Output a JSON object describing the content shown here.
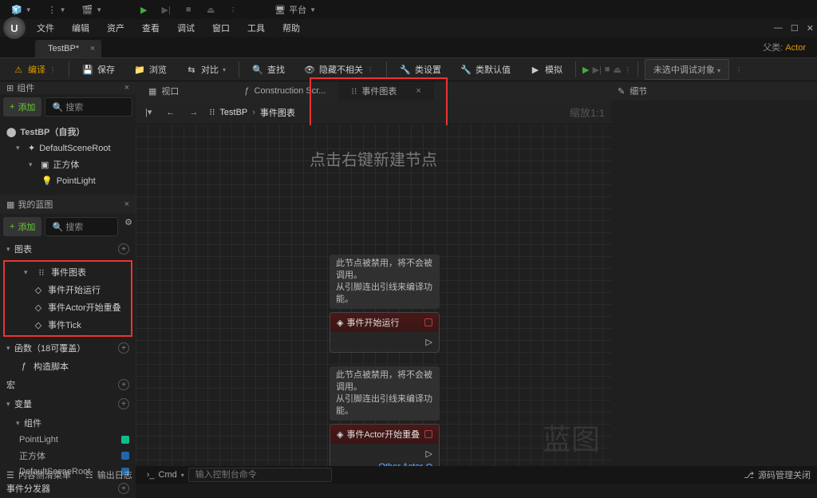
{
  "menubar": {
    "items": [
      "文件",
      "编辑",
      "资产",
      "查看",
      "调试",
      "窗口",
      "工具",
      "帮助"
    ]
  },
  "titlebar": {
    "platform_label": "平台"
  },
  "tabs": {
    "name": "TestBP*",
    "class_label": "父类:",
    "class": "Actor"
  },
  "toolbar": {
    "compile": "编译",
    "save": "保存",
    "browse": "浏览",
    "diff": "对比",
    "find": "查找",
    "hide_unrelated": "隐藏不相关",
    "class_settings": "类设置",
    "class_defaults": "类默认值",
    "simulation": "模拟",
    "debug_selector": "未选中调试对象"
  },
  "left_panel": {
    "components_tab": "组件",
    "add_label": "添加",
    "search_placeholder": "搜索",
    "root": "TestBP（自我）",
    "items": [
      "DefaultSceneRoot",
      "正方体",
      "PointLight"
    ],
    "my_blueprint": "我的蓝图",
    "sections": {
      "graph": "图表",
      "event_graph": "事件图表",
      "events": [
        "事件开始运行",
        "事件Actor开始重叠",
        "事件Tick"
      ],
      "functions": "函数（18可覆盖）",
      "construction": "构造脚本",
      "macro": "宏",
      "variables": "变量",
      "components_label": "组件",
      "vars": [
        "PointLight",
        "正方体",
        "DefaultSceneRoot"
      ],
      "dispatchers": "事件分发器"
    }
  },
  "main": {
    "tabs": {
      "viewport": "视口",
      "construction": "Construction Scr...",
      "event_graph": "事件图表"
    },
    "nav": {
      "crumb_root": "TestBP",
      "crumb_leaf": "事件图表",
      "zoom": "缩放1:1"
    },
    "hint": "点击右键新建节点",
    "watermark": "蓝图",
    "node1": {
      "comment1": "此节点被禁用，将不会被调用。",
      "comment2": "从引脚连出引线来编译功能。",
      "title": "事件开始运行"
    },
    "node2": {
      "comment1": "此节点被禁用，将不会被调用。",
      "comment2": "从引脚连出引线来编译功能。",
      "title": "事件Actor开始重叠",
      "pin": "Other Actor"
    }
  },
  "right_panel": {
    "details": "细节"
  },
  "statusbar": {
    "content_drawer": "内容侧滑菜单",
    "output_log": "输出日志",
    "cmd_label": "Cmd",
    "cmd_placeholder": "输入控制台命令",
    "source_control": "源码管理关闭"
  }
}
